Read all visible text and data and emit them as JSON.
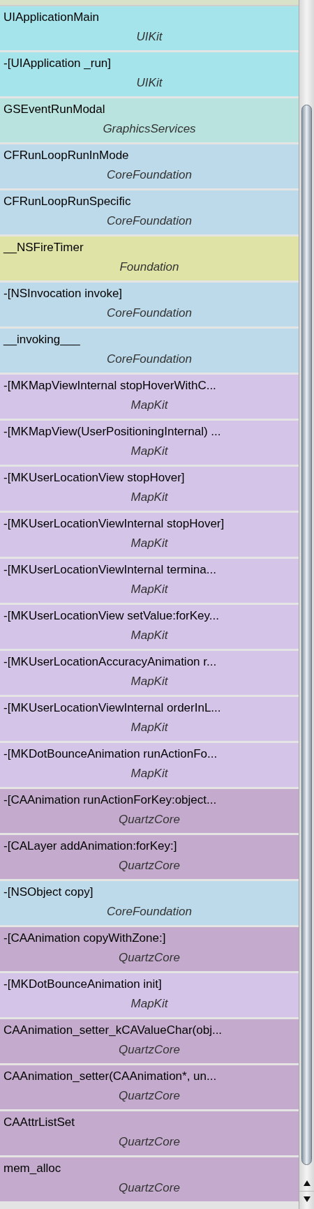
{
  "frames": [
    {
      "symbol": "UIApplicationMain",
      "library": "UIKit",
      "color": "#a4e4ea"
    },
    {
      "symbol": "-[UIApplication _run]",
      "library": "UIKit",
      "color": "#a4e4ea"
    },
    {
      "symbol": "GSEventRunModal",
      "library": "GraphicsServices",
      "color": "#b9e3de"
    },
    {
      "symbol": "CFRunLoopRunInMode",
      "library": "CoreFoundation",
      "color": "#bcdaea"
    },
    {
      "symbol": "CFRunLoopRunSpecific",
      "library": "CoreFoundation",
      "color": "#bcdaea"
    },
    {
      "symbol": "__NSFireTimer",
      "library": "Foundation",
      "color": "#dfe3a6"
    },
    {
      "symbol": "-[NSInvocation invoke]",
      "library": "CoreFoundation",
      "color": "#bcdaea"
    },
    {
      "symbol": "__invoking___",
      "library": "CoreFoundation",
      "color": "#bcdaea"
    },
    {
      "symbol": "-[MKMapViewInternal stopHoverWithC...",
      "library": "MapKit",
      "color": "#d4c4e8"
    },
    {
      "symbol": "-[MKMapView(UserPositioningInternal) ...",
      "library": "MapKit",
      "color": "#d4c4e8"
    },
    {
      "symbol": "-[MKUserLocationView stopHover]",
      "library": "MapKit",
      "color": "#d4c4e8"
    },
    {
      "symbol": "-[MKUserLocationViewInternal stopHover]",
      "library": "MapKit",
      "color": "#d4c4e8"
    },
    {
      "symbol": "-[MKUserLocationViewInternal termina...",
      "library": "MapKit",
      "color": "#d4c4e8"
    },
    {
      "symbol": "-[MKUserLocationView setValue:forKey...",
      "library": "MapKit",
      "color": "#d4c4e8"
    },
    {
      "symbol": "-[MKUserLocationAccuracyAnimation r...",
      "library": "MapKit",
      "color": "#d4c4e8"
    },
    {
      "symbol": "-[MKUserLocationViewInternal orderInL...",
      "library": "MapKit",
      "color": "#d4c4e8"
    },
    {
      "symbol": "-[MKDotBounceAnimation runActionFo...",
      "library": "MapKit",
      "color": "#d4c4e8"
    },
    {
      "symbol": "-[CAAnimation runActionForKey:object...",
      "library": "QuartzCore",
      "color": "#c4abcd"
    },
    {
      "symbol": "-[CALayer addAnimation:forKey:]",
      "library": "QuartzCore",
      "color": "#c4abcd"
    },
    {
      "symbol": "-[NSObject copy]",
      "library": "CoreFoundation",
      "color": "#bcdaea"
    },
    {
      "symbol": "-[CAAnimation copyWithZone:]",
      "library": "QuartzCore",
      "color": "#c4abcd"
    },
    {
      "symbol": "-[MKDotBounceAnimation init]",
      "library": "MapKit",
      "color": "#d4c4e8"
    },
    {
      "symbol": "CAAnimation_setter_kCAValueChar(obj...",
      "library": "QuartzCore",
      "color": "#c4abcd"
    },
    {
      "symbol": "CAAnimation_setter(CAAnimation*, un...",
      "library": "QuartzCore",
      "color": "#c4abcd"
    },
    {
      "symbol": "CAAttrListSet",
      "library": "QuartzCore",
      "color": "#c4abcd"
    },
    {
      "symbol": "mem_alloc",
      "library": "QuartzCore",
      "color": "#c4abcd"
    }
  ]
}
